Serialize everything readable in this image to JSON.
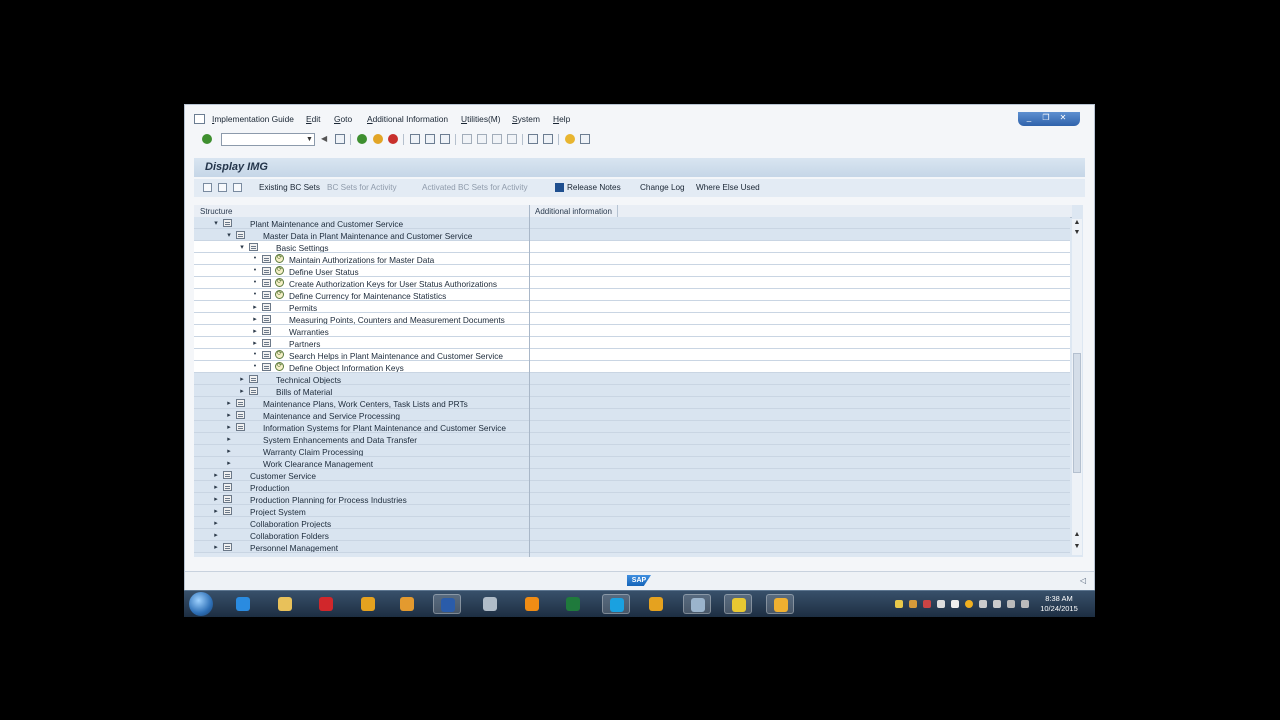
{
  "menu": {
    "items": [
      "Implementation Guide",
      "Edit",
      "Goto",
      "Additional Information",
      "Utilities(M)",
      "System",
      "Help"
    ]
  },
  "window_controls": {
    "minimize": "_",
    "restore": "❐",
    "close": "✕"
  },
  "toolbar": {
    "command_value": "",
    "icons": [
      "enter-icon",
      "save-icon",
      "back-icon",
      "exit-icon",
      "cancel-icon",
      "print-icon",
      "find-icon",
      "find-next-icon",
      "first-page-icon",
      "prev-page-icon",
      "next-page-icon",
      "last-page-icon",
      "new-session-icon",
      "shortcut-icon",
      "help-icon",
      "layout-icon"
    ]
  },
  "page": {
    "title": "Display IMG"
  },
  "app_toolbar": {
    "existing_bc_sets": "Existing BC Sets",
    "bc_sets_for_activity": "BC Sets for Activity",
    "activated_bc_sets": "Activated BC Sets for Activity",
    "release_notes": "Release Notes",
    "change_log": "Change Log",
    "where_else_used": "Where Else Used"
  },
  "tree": {
    "columns": [
      "Structure",
      "Additional information"
    ],
    "rows": [
      {
        "label": "Plant Maintenance and Customer Service",
        "level": 0,
        "expander": "open",
        "doc": true,
        "exec": false,
        "bg": "blue"
      },
      {
        "label": "Master Data in Plant Maintenance and Customer Service",
        "level": 1,
        "expander": "open",
        "doc": true,
        "exec": false,
        "bg": "blue"
      },
      {
        "label": "Basic Settings",
        "level": 2,
        "expander": "open",
        "doc": true,
        "exec": false,
        "bg": "white"
      },
      {
        "label": "Maintain Authorizations for Master Data",
        "level": 3,
        "expander": "dot",
        "doc": true,
        "exec": true,
        "bg": "white"
      },
      {
        "label": "Define User Status",
        "level": 3,
        "expander": "dot",
        "doc": true,
        "exec": true,
        "bg": "white"
      },
      {
        "label": "Create Authorization Keys for User Status Authorizations",
        "level": 3,
        "expander": "dot",
        "doc": true,
        "exec": true,
        "bg": "white"
      },
      {
        "label": "Define Currency for Maintenance Statistics",
        "level": 3,
        "expander": "dot",
        "doc": true,
        "exec": true,
        "bg": "white"
      },
      {
        "label": "Permits",
        "level": 3,
        "expander": "closed",
        "doc": true,
        "exec": false,
        "bg": "white"
      },
      {
        "label": "Measuring Points, Counters and Measurement Documents",
        "level": 3,
        "expander": "closed",
        "doc": true,
        "exec": false,
        "bg": "white"
      },
      {
        "label": "Warranties",
        "level": 3,
        "expander": "closed",
        "doc": true,
        "exec": false,
        "bg": "white"
      },
      {
        "label": "Partners",
        "level": 3,
        "expander": "closed",
        "doc": true,
        "exec": false,
        "bg": "white"
      },
      {
        "label": "Search Helps in Plant Maintenance and Customer Service",
        "level": 3,
        "expander": "dot",
        "doc": true,
        "exec": true,
        "bg": "white"
      },
      {
        "label": "Define Object Information Keys",
        "level": 3,
        "expander": "dot",
        "doc": true,
        "exec": true,
        "bg": "white"
      },
      {
        "label": "Technical Objects",
        "level": 2,
        "expander": "closed",
        "doc": true,
        "exec": false,
        "bg": "blue"
      },
      {
        "label": "Bills of Material",
        "level": 2,
        "expander": "closed",
        "doc": true,
        "exec": false,
        "bg": "blue"
      },
      {
        "label": "Maintenance Plans, Work Centers, Task Lists and PRTs",
        "level": 1,
        "expander": "closed",
        "doc": true,
        "exec": false,
        "bg": "blue"
      },
      {
        "label": "Maintenance and Service Processing",
        "level": 1,
        "expander": "closed",
        "doc": true,
        "exec": false,
        "bg": "blue"
      },
      {
        "label": "Information Systems for Plant Maintenance and Customer Service",
        "level": 1,
        "expander": "closed",
        "doc": true,
        "exec": false,
        "bg": "blue"
      },
      {
        "label": "System Enhancements and Data Transfer",
        "level": 1,
        "expander": "closed",
        "doc": false,
        "exec": false,
        "bg": "blue"
      },
      {
        "label": "Warranty Claim Processing",
        "level": 1,
        "expander": "closed",
        "doc": false,
        "exec": false,
        "bg": "blue"
      },
      {
        "label": "Work Clearance Management",
        "level": 1,
        "expander": "closed",
        "doc": false,
        "exec": false,
        "bg": "blue"
      },
      {
        "label": "Customer Service",
        "level": 0,
        "expander": "closed",
        "doc": true,
        "exec": false,
        "bg": "blue"
      },
      {
        "label": "Production",
        "level": 0,
        "expander": "closed",
        "doc": true,
        "exec": false,
        "bg": "blue"
      },
      {
        "label": "Production Planning for Process Industries",
        "level": 0,
        "expander": "closed",
        "doc": true,
        "exec": false,
        "bg": "blue"
      },
      {
        "label": "Project System",
        "level": 0,
        "expander": "closed",
        "doc": true,
        "exec": false,
        "bg": "blue"
      },
      {
        "label": "Collaboration Projects",
        "level": 0,
        "expander": "closed",
        "doc": false,
        "exec": false,
        "bg": "blue"
      },
      {
        "label": "Collaboration Folders",
        "level": 0,
        "expander": "closed",
        "doc": false,
        "exec": false,
        "bg": "blue"
      },
      {
        "label": "Personnel Management",
        "level": 0,
        "expander": "closed",
        "doc": true,
        "exec": false,
        "bg": "blue"
      }
    ]
  },
  "status_bar": {
    "logo": "SAP"
  },
  "taskbar": {
    "apps": [
      {
        "name": "internet-explorer-icon",
        "color": "#2a8be0",
        "active": false
      },
      {
        "name": "file-explorer-icon",
        "color": "#e8c15a",
        "active": false
      },
      {
        "name": "acrobat-icon",
        "color": "#d1272b",
        "active": false
      },
      {
        "name": "chrome-icon",
        "color": "#e5a21f",
        "active": false
      },
      {
        "name": "media-icon",
        "color": "#e39a2f",
        "active": false
      },
      {
        "name": "word-icon",
        "color": "#2a5caa",
        "active": true
      },
      {
        "name": "sap-gui-icon",
        "color": "#b0bcc8",
        "active": false
      },
      {
        "name": "vlc-icon",
        "color": "#f08c14",
        "active": false
      },
      {
        "name": "excel-icon",
        "color": "#1f7a3c",
        "active": false
      },
      {
        "name": "skype-icon",
        "color": "#1aa1e0",
        "active": true
      },
      {
        "name": "chrome-icon-2",
        "color": "#e5a21f",
        "active": false
      },
      {
        "name": "sap-logon-icon",
        "color": "#9bb4cc",
        "active": true
      },
      {
        "name": "notes-icon",
        "color": "#e8c832",
        "active": true
      },
      {
        "name": "flower-app-icon",
        "color": "#f0b030",
        "active": true
      }
    ],
    "time": "8:38 AM",
    "date": "10/24/2015"
  }
}
